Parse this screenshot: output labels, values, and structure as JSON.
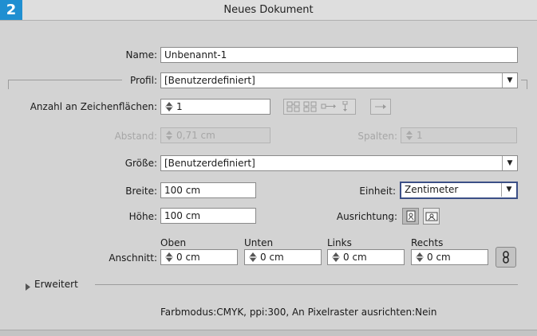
{
  "window": {
    "title": "Neues Dokument",
    "badge": "2"
  },
  "name": {
    "label": "Name:",
    "value": "Unbenannt-1"
  },
  "profile": {
    "label": "Profil:",
    "value": "[Benutzerdefiniert]"
  },
  "artboards": {
    "label": "Anzahl an Zeichenflächen:",
    "value": "1"
  },
  "spacing": {
    "label": "Abstand:",
    "value": "0,71 cm"
  },
  "columns": {
    "label": "Spalten:",
    "value": "1"
  },
  "size": {
    "label": "Größe:",
    "value": "[Benutzerdefiniert]"
  },
  "width": {
    "label": "Breite:",
    "value": "100 cm"
  },
  "unit": {
    "label": "Einheit:",
    "value": "Zentimeter"
  },
  "height": {
    "label": "Höhe:",
    "value": "100 cm"
  },
  "orientation": {
    "label": "Ausrichtung:",
    "selected": "portrait"
  },
  "bleed": {
    "label": "Anschnitt:",
    "top": {
      "label": "Oben",
      "value": "0 cm"
    },
    "bottom": {
      "label": "Unten",
      "value": "0 cm"
    },
    "left": {
      "label": "Links",
      "value": "0 cm"
    },
    "right": {
      "label": "Rechts",
      "value": "0 cm"
    }
  },
  "advanced": {
    "label": "Erweitert"
  },
  "info": {
    "text": "Farbmodus:CMYK, ppi:300, An Pixelraster ausrichten:Nein"
  },
  "icons": [
    "spinner-arrows-icon",
    "dropdown-arrow-icon",
    "grid-by-row-icon",
    "grid-by-column-icon",
    "arrange-by-row-icon",
    "arrange-by-column-icon",
    "right-to-left-icon",
    "portrait-icon",
    "landscape-icon",
    "chain-link-icon",
    "disclosure-triangle-icon"
  ],
  "colors": {
    "badge": "#1f8fd1",
    "focus": "#3b4f86",
    "background": "#d3d3d3"
  }
}
